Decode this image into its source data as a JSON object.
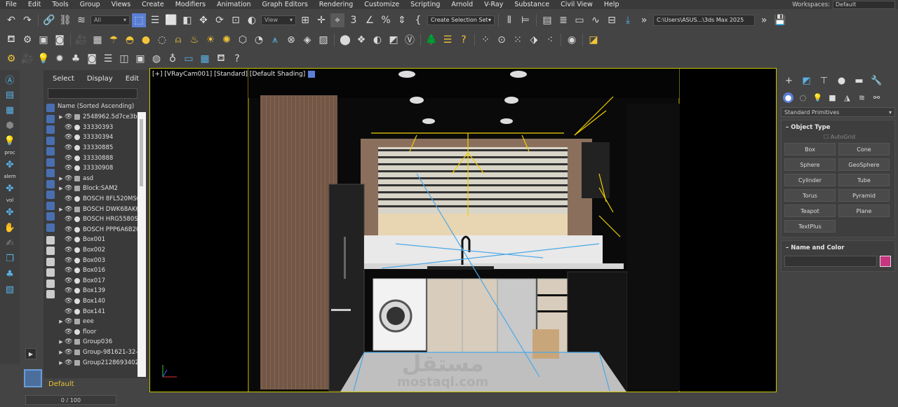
{
  "menu": [
    "File",
    "Edit",
    "Tools",
    "Group",
    "Views",
    "Create",
    "Modifiers",
    "Animation",
    "Graph Editors",
    "Rendering",
    "Customize",
    "Scripting",
    "Arnold",
    "V-Ray",
    "Substance",
    "Civil View",
    "Help"
  ],
  "workspaces": {
    "label": "Workspaces:",
    "value": "Default"
  },
  "toolbar": {
    "filter_dropdown": "All",
    "ref_coord_dropdown": "View",
    "selection_set": "Create Selection Set",
    "project_path": "C:\\Users\\ASUS...\\3ds Max 2025"
  },
  "scene_explorer": {
    "tabs": [
      "Select",
      "Display",
      "Edit"
    ],
    "column_header": "Name (Sorted Ascending)",
    "rows": [
      {
        "expand": "▶",
        "name": "2548962.5d7ce3b3"
      },
      {
        "expand": "",
        "name": "33330393"
      },
      {
        "expand": "",
        "name": "33330394"
      },
      {
        "expand": "",
        "name": "33330885"
      },
      {
        "expand": "",
        "name": "33330888"
      },
      {
        "expand": "",
        "name": "33330908"
      },
      {
        "expand": "▶",
        "name": "asd"
      },
      {
        "expand": "▶",
        "name": "Block:SAM2"
      },
      {
        "expand": "",
        "name": "BOSCH 8FL520MS0"
      },
      {
        "expand": "▶",
        "name": "BOSCH DWK68AK6"
      },
      {
        "expand": "",
        "name": "BOSCH HRG5580S"
      },
      {
        "expand": "",
        "name": "BOSCH PPP6A6B20"
      },
      {
        "expand": "",
        "name": "Box001"
      },
      {
        "expand": "",
        "name": "Box002"
      },
      {
        "expand": "",
        "name": "Box003"
      },
      {
        "expand": "",
        "name": "Box016"
      },
      {
        "expand": "",
        "name": "Box017"
      },
      {
        "expand": "",
        "name": "Box139"
      },
      {
        "expand": "",
        "name": "Box140"
      },
      {
        "expand": "",
        "name": "Box141"
      },
      {
        "expand": "▶",
        "name": "eee"
      },
      {
        "expand": "",
        "name": "floor"
      },
      {
        "expand": "▶",
        "name": "Group036"
      },
      {
        "expand": "▶",
        "name": "Group-981621-32-"
      },
      {
        "expand": "▶",
        "name": "Group2128693402"
      }
    ]
  },
  "left_strip_labels": [
    "proc",
    "alem",
    "vol"
  ],
  "layer": {
    "name": "Default"
  },
  "timeline": {
    "value": "0 / 100"
  },
  "viewport": {
    "label": "[+] [VRayCam001] [Standard] [Default Shading]"
  },
  "watermark": {
    "arabic": "مستقل",
    "latin": "mostaql.com"
  },
  "command_panel": {
    "category": "Standard Primitives",
    "object_type": {
      "title": "Object Type",
      "autogrid": "AutoGrid",
      "buttons": [
        "Box",
        "Cone",
        "Sphere",
        "GeoSphere",
        "Cylinder",
        "Tube",
        "Torus",
        "Pyramid",
        "Teapot",
        "Plane",
        "TextPlus"
      ]
    },
    "name_color": {
      "title": "Name and Color",
      "color": "#c6357f"
    }
  }
}
